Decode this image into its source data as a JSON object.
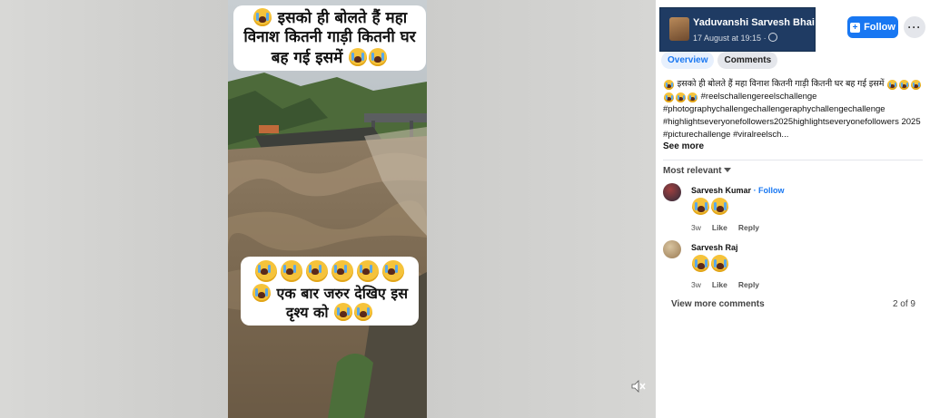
{
  "video": {
    "caption_top": "इसको ही बोलते हैं महा विनाश कितनी गाड़ी कितनी घर बह गई इसमें",
    "caption_bottom": "एक बार जरुर देखिए इस दृश्य को",
    "mute_icon": "speaker-muted-icon"
  },
  "post": {
    "author": "Yaduvanshi Sarvesh Bhai",
    "timestamp": "17 August at 19:15 ·",
    "follow_label": "Follow",
    "more_label": "···",
    "tabs": [
      {
        "label": "Overview",
        "active": true
      },
      {
        "label": "Comments",
        "active": false
      }
    ],
    "caption_text": "इसको ही बोलते हैं महा विनाश कितनी गाड़ी कितनी घर बह गई इसमें",
    "caption_hashtags": "#reelschallengereelschallenge #photographychallengechallengeraphychallengechallenge #highlightseveryonefollowers2025highlightseveryonefollowers 2025 #picturechallenge #viralreelsch...",
    "see_more": "See more"
  },
  "comments": {
    "sort_label": "Most relevant",
    "items": [
      {
        "name": "Sarvesh Kumar",
        "follow": "· Follow",
        "age": "3w",
        "like": "Like",
        "reply": "Reply"
      },
      {
        "name": "Sarvesh Raj",
        "follow": "",
        "age": "3w",
        "like": "Like",
        "reply": "Reply"
      }
    ],
    "view_more": "View more comments",
    "count": "2 of 9"
  },
  "colors": {
    "brand_blue": "#1877f2",
    "header_highlight": "#1f3b63"
  }
}
